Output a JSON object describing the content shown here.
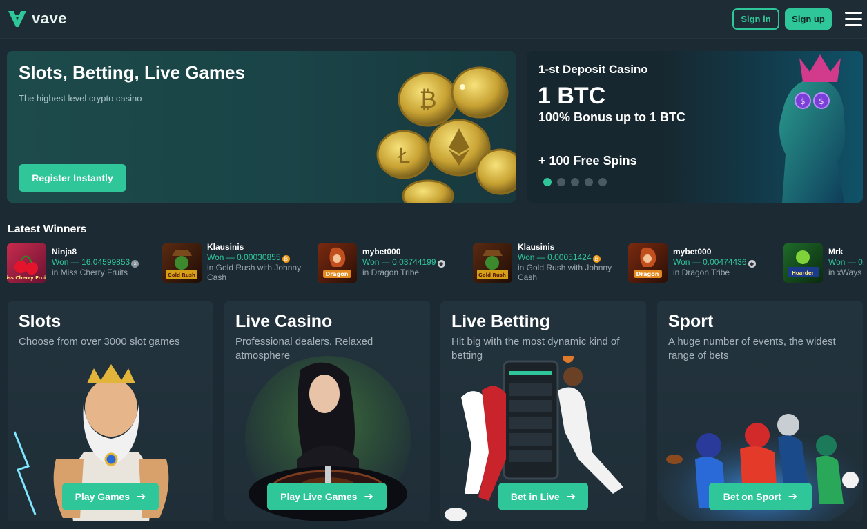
{
  "header": {
    "logo_text": "vave",
    "signin_label": "Sign in",
    "signup_label": "Sign up"
  },
  "hero": {
    "title": "Slots, Betting, Live Games",
    "subtitle": "The highest level crypto casino",
    "register_label": "Register Instantly"
  },
  "promo": {
    "label": "1-st Deposit Casino",
    "amount": "1 BTC",
    "bonus": "100% Bonus up to 1 BTC",
    "spins": "+ 100 Free Spins",
    "active_slide": 1,
    "slide_count": 5
  },
  "winners": {
    "title": "Latest Winners",
    "items": [
      {
        "name": "Ninja8",
        "won": "Won — 16.04599853",
        "coin": "x-coin-icon",
        "game": "in Miss Cherry Fruits"
      },
      {
        "name": "Klausinis",
        "won": "Won — 0.00030855",
        "coin": "bitcoin-icon",
        "game": "in Gold Rush with Johnny Cash"
      },
      {
        "name": "mybet000",
        "won": "Won — 0.03744199",
        "coin": "ethereum-icon",
        "game": "in Dragon Tribe"
      },
      {
        "name": "Klausinis",
        "won": "Won — 0.00051424",
        "coin": "bitcoin-icon",
        "game": "in Gold Rush with Johnny Cash"
      },
      {
        "name": "mybet000",
        "won": "Won — 0.00474436",
        "coin": "ethereum-icon",
        "game": "in Dragon Tribe"
      },
      {
        "name": "Mrk",
        "won": "Won — 0.",
        "coin": "",
        "game": "in xWays"
      }
    ],
    "thumb_labels": [
      "Miss Cherry Fruits",
      "Gold Rush",
      "Dragon",
      "Gold Rush",
      "Dragon",
      "Hoarder"
    ]
  },
  "categories": [
    {
      "title": "Slots",
      "desc": "Choose from over 3000 slot games",
      "button": "Play Games"
    },
    {
      "title": "Live Casino",
      "desc": "Professional dealers. Relaxed atmosphere",
      "button": "Play Live Games"
    },
    {
      "title": "Live Betting",
      "desc": "Hit big with the most dynamic kind of betting",
      "button": "Bet in Live"
    },
    {
      "title": "Sport",
      "desc": "A huge number of events, the widest range of bets",
      "button": "Bet on Sport"
    }
  ],
  "colors": {
    "accent": "#2fc79a",
    "background": "#1c2a33",
    "card": "#23333d"
  }
}
